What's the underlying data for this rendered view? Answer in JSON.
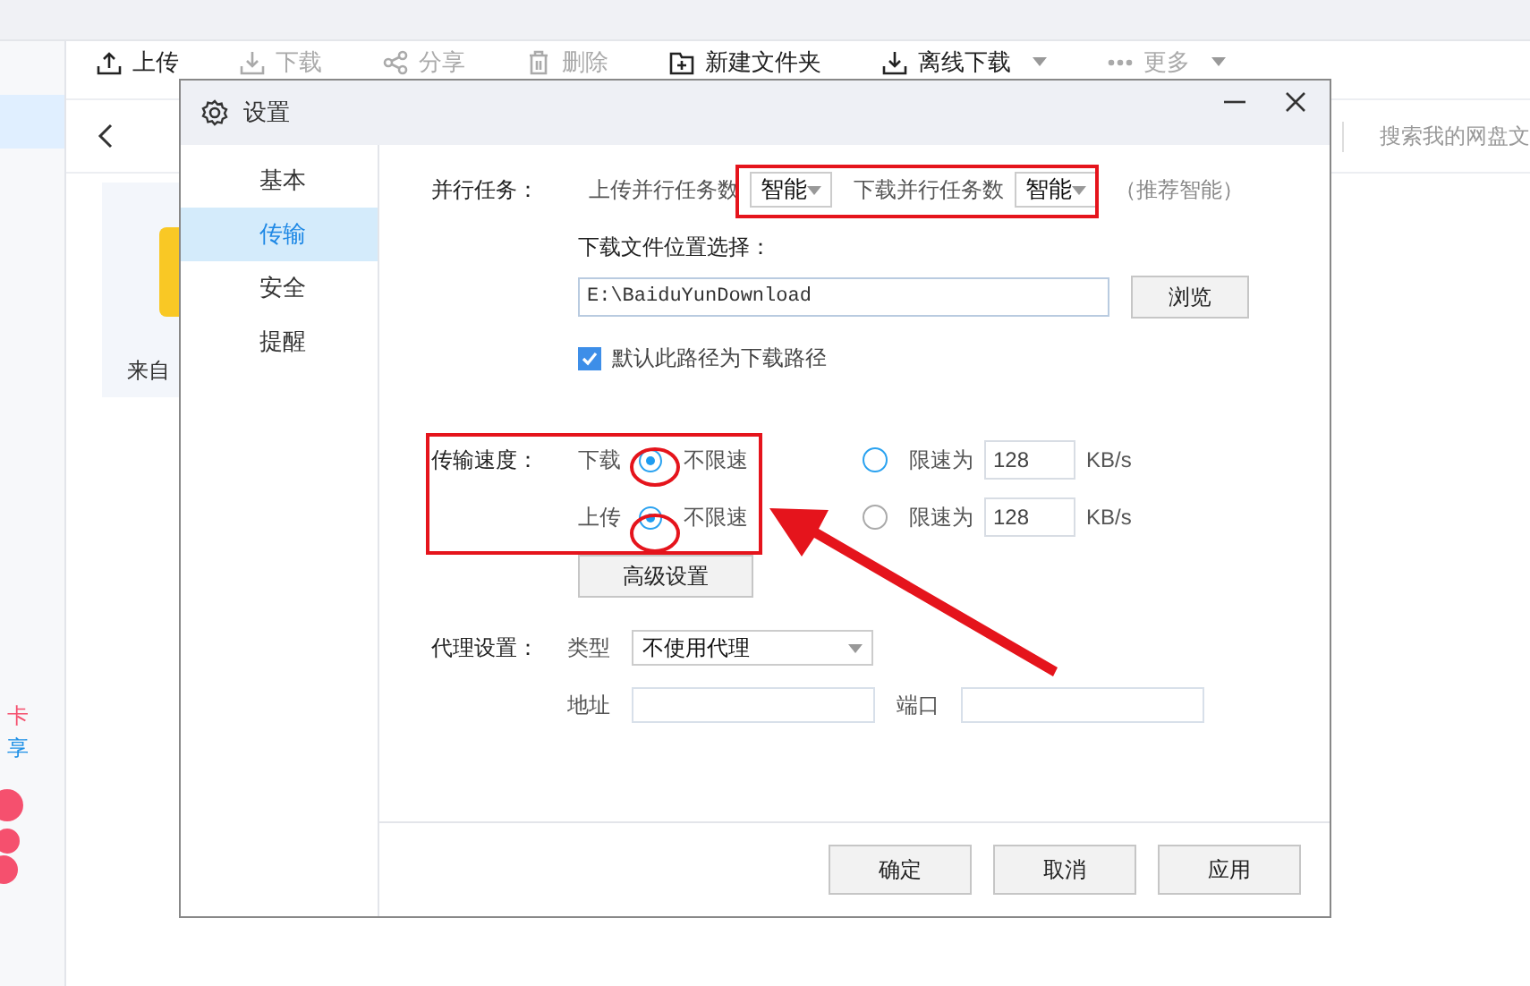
{
  "toolbar": [
    {
      "label": "上传",
      "kind": "upload",
      "disabled": false,
      "caret": false
    },
    {
      "label": "下载",
      "kind": "download",
      "disabled": true,
      "caret": false
    },
    {
      "label": "分享",
      "kind": "share",
      "disabled": true,
      "caret": false
    },
    {
      "label": "删除",
      "kind": "trash",
      "disabled": true,
      "caret": false
    },
    {
      "label": "新建文件夹",
      "kind": "folder",
      "disabled": false,
      "caret": false
    },
    {
      "label": "离线下载",
      "kind": "download",
      "disabled": false,
      "caret": true
    },
    {
      "label": "更多",
      "kind": "dots",
      "disabled": true,
      "caret": true
    }
  ],
  "search": {
    "placeholder": "搜索我的网盘文"
  },
  "folder_card": {
    "label": "来自"
  },
  "side_snippets": [
    {
      "text": "卡",
      "color": "#f5506e"
    },
    {
      "text": "享",
      "color": "#1e90e6"
    }
  ],
  "dialog": {
    "title": "设置",
    "nav": [
      {
        "label": "基本",
        "selected": false
      },
      {
        "label": "传输",
        "selected": true
      },
      {
        "label": "安全",
        "selected": false
      },
      {
        "label": "提醒",
        "selected": false
      }
    ],
    "parallel": {
      "label": "并行任务：",
      "upload_label": "上传并行任务数",
      "upload_value": "智能",
      "download_label": "下载并行任务数",
      "download_value": "智能",
      "hint": "（推荐智能）"
    },
    "location": {
      "label": "下载文件位置选择：",
      "value": "E:\\BaiduYunDownload",
      "browse": "浏览",
      "default_checked": true,
      "default_label": "默认此路径为下载路径"
    },
    "speed": {
      "label": "传输速度：",
      "rows": [
        {
          "label": "下载",
          "unlimited_label": "不限速",
          "unlimited_selected": true,
          "limit_label": "限速为",
          "limit_selected": false,
          "value": "128",
          "unit": "KB/s"
        },
        {
          "label": "上传",
          "unlimited_label": "不限速",
          "unlimited_selected": true,
          "limit_label": "限速为",
          "limit_selected": false,
          "value": "128",
          "unit": "KB/s"
        }
      ],
      "advanced": "高级设置"
    },
    "proxy": {
      "label": "代理设置：",
      "type_label": "类型",
      "type_value": "不使用代理",
      "address_label": "地址",
      "port_label": "端口"
    },
    "buttons": [
      "确定",
      "取消",
      "应用"
    ]
  }
}
